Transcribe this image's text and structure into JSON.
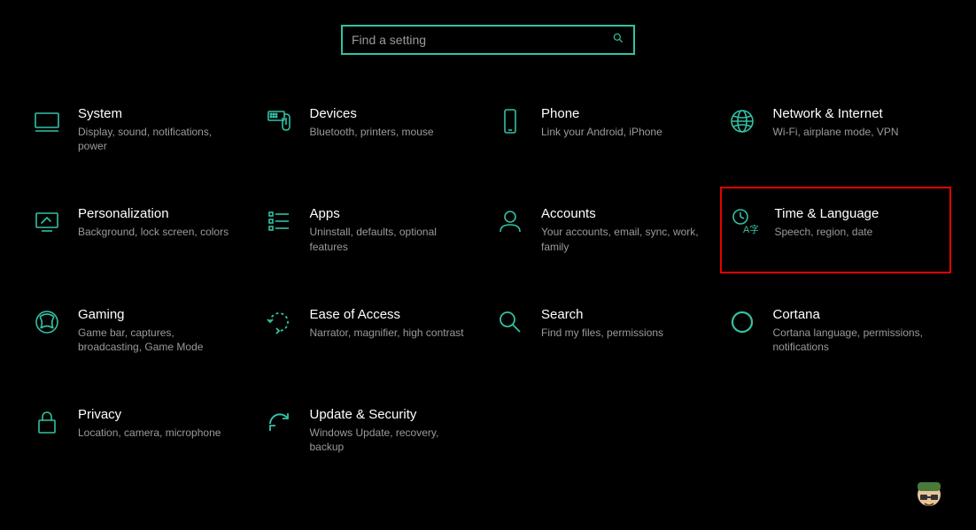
{
  "search": {
    "placeholder": "Find a setting"
  },
  "accent": "#33c1a4",
  "highlightIndex": 9,
  "categories": [
    {
      "icon": "system",
      "title": "System",
      "desc": "Display, sound, notifications, power"
    },
    {
      "icon": "devices",
      "title": "Devices",
      "desc": "Bluetooth, printers, mouse"
    },
    {
      "icon": "phone",
      "title": "Phone",
      "desc": "Link your Android, iPhone"
    },
    {
      "icon": "network",
      "title": "Network & Internet",
      "desc": "Wi-Fi, airplane mode, VPN"
    },
    {
      "icon": "personalization",
      "title": "Personalization",
      "desc": "Background, lock screen, colors"
    },
    {
      "icon": "apps",
      "title": "Apps",
      "desc": "Uninstall, defaults, optional features"
    },
    {
      "icon": "accounts",
      "title": "Accounts",
      "desc": "Your accounts, email, sync, work, family"
    },
    {
      "icon": "time",
      "title": "Time & Language",
      "desc": "Speech, region, date"
    },
    {
      "icon": "gaming",
      "title": "Gaming",
      "desc": "Game bar, captures, broadcasting, Game Mode"
    },
    {
      "icon": "ease",
      "title": "Ease of Access",
      "desc": "Narrator, magnifier, high contrast"
    },
    {
      "icon": "search",
      "title": "Search",
      "desc": "Find my files, permissions"
    },
    {
      "icon": "cortana",
      "title": "Cortana",
      "desc": "Cortana language, permissions, notifications"
    },
    {
      "icon": "privacy",
      "title": "Privacy",
      "desc": "Location, camera, microphone"
    },
    {
      "icon": "update",
      "title": "Update & Security",
      "desc": "Windows Update, recovery, backup"
    }
  ]
}
